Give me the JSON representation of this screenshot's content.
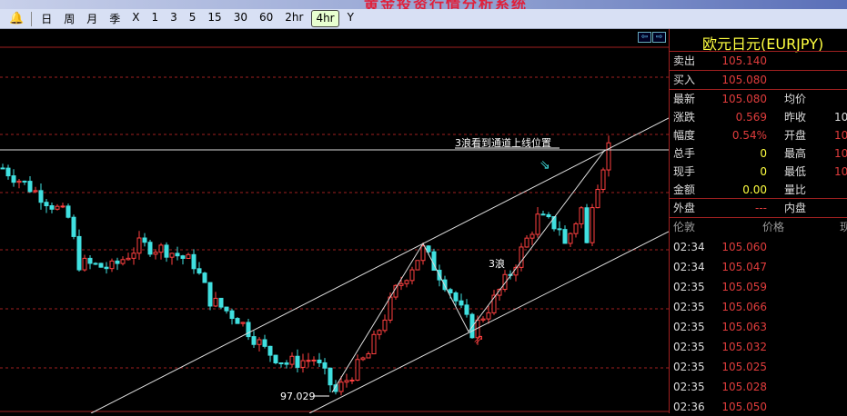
{
  "title": "黄金投资行情分析系统",
  "toolbar": {
    "periods": [
      "日",
      "周",
      "月",
      "季",
      "X",
      "1",
      "3",
      "5",
      "15",
      "30",
      "60",
      "2hr",
      "4hr",
      "Y"
    ],
    "active": "4hr"
  },
  "symbol": "欧元日元(EURJPY)",
  "quote": {
    "sell_label": "卖出",
    "sell": "105.140",
    "buy_label": "买入",
    "buy": "105.080",
    "rows": [
      {
        "l": "最新",
        "v": "105.080",
        "c": "red",
        "l2": "均价",
        "v2": ""
      },
      {
        "l": "涨跌",
        "v": "0.569",
        "c": "red",
        "l2": "昨收",
        "v2": "10"
      },
      {
        "l": "幅度",
        "v": "0.54%",
        "c": "red",
        "l2": "开盘",
        "v2": "10"
      },
      {
        "l": "总手",
        "v": "0",
        "c": "yel",
        "l2": "最高",
        "v2": "10"
      },
      {
        "l": "现手",
        "v": "0",
        "c": "yel",
        "l2": "最低",
        "v2": "10"
      },
      {
        "l": "金额",
        "v": "0.00",
        "c": "yel",
        "l2": "量比",
        "v2": ""
      }
    ],
    "outer_label": "外盘",
    "outer": "---",
    "inner_label": "内盘"
  },
  "ticks": {
    "headers": [
      "伦敦",
      "价格",
      "现"
    ],
    "rows": [
      [
        "02:34",
        "105.060"
      ],
      [
        "02:34",
        "105.047"
      ],
      [
        "02:35",
        "105.059"
      ],
      [
        "02:35",
        "105.066"
      ],
      [
        "02:35",
        "105.063"
      ],
      [
        "02:35",
        "105.032"
      ],
      [
        "02:35",
        "105.025"
      ],
      [
        "02:35",
        "105.028"
      ],
      [
        "02:36",
        "105.050"
      ]
    ]
  },
  "chart": {
    "annotation": "3浪看到通道上线位置",
    "wave_label": "3浪",
    "low_label": "97.029",
    "up_color": "#ff4040",
    "down_color": "#40e0e0",
    "price_path": [
      [
        0,
        104.48
      ],
      [
        7,
        103.58
      ],
      [
        12,
        102.84
      ],
      [
        14,
        101.35
      ],
      [
        20,
        101.2
      ],
      [
        25,
        101.95
      ],
      [
        30,
        101.8
      ],
      [
        35,
        101.35
      ],
      [
        38,
        100.16
      ],
      [
        43,
        99.56
      ],
      [
        48,
        98.52
      ],
      [
        52,
        98.07
      ],
      [
        57,
        98.22
      ],
      [
        61,
        97.12
      ],
      [
        67,
        98.37
      ],
      [
        72,
        100.46
      ],
      [
        77,
        101.8
      ],
      [
        82,
        100.46
      ],
      [
        86,
        99.12
      ],
      [
        90,
        100.16
      ],
      [
        93,
        101.05
      ],
      [
        98,
        102.84
      ],
      [
        102,
        102.54
      ],
      [
        103,
        101.95
      ],
      [
        106,
        103.14
      ],
      [
        107,
        101.95
      ],
      [
        108,
        103.43
      ],
      [
        111,
        105.22
      ]
    ]
  }
}
